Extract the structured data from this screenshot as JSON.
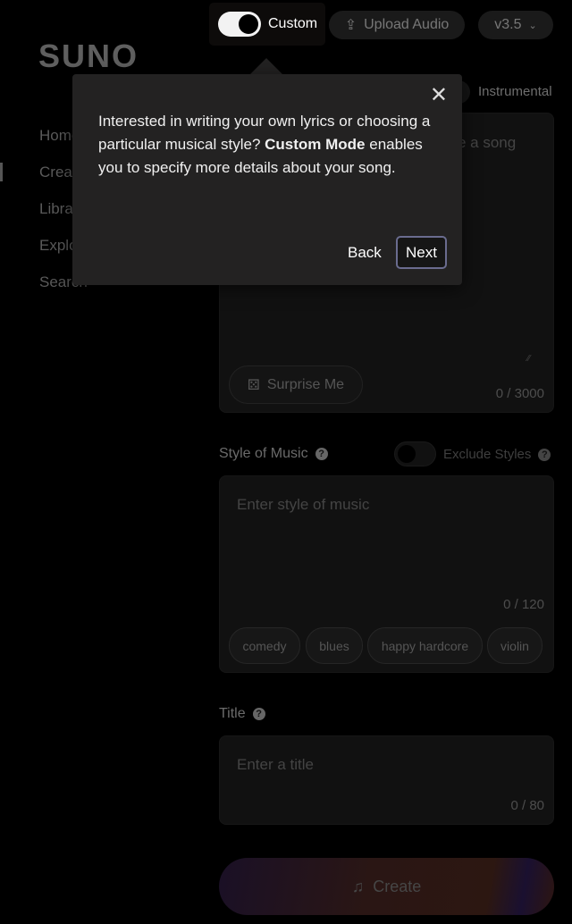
{
  "sidebar": {
    "logo": "SUNO",
    "items": [
      {
        "label": "Home"
      },
      {
        "label": "Create"
      },
      {
        "label": "Library"
      },
      {
        "label": "Explore"
      },
      {
        "label": "Search"
      }
    ]
  },
  "topbar": {
    "custom_label": "Custom",
    "custom_on": true,
    "upload_label": "Upload Audio",
    "version": "v3.5"
  },
  "lyrics": {
    "instrumental_label": "Instrumental",
    "placeholder": "e a song",
    "surprise_label": "Surprise Me",
    "count": "0 / 3000"
  },
  "style": {
    "label": "Style of Music",
    "exclude_label": "Exclude Styles",
    "placeholder": "Enter style of music",
    "count": "0 / 120",
    "chips": [
      "comedy",
      "blues",
      "happy hardcore",
      "violin"
    ]
  },
  "title": {
    "label": "Title",
    "placeholder": "Enter a title",
    "count": "0 / 80"
  },
  "create_label": "Create",
  "popover": {
    "text_before": "Interested in writing your own lyrics or choosing a particular musical style? ",
    "text_bold": "Custom Mode",
    "text_after": " enables you to specify more details about your song.",
    "back_label": "Back",
    "next_label": "Next"
  }
}
